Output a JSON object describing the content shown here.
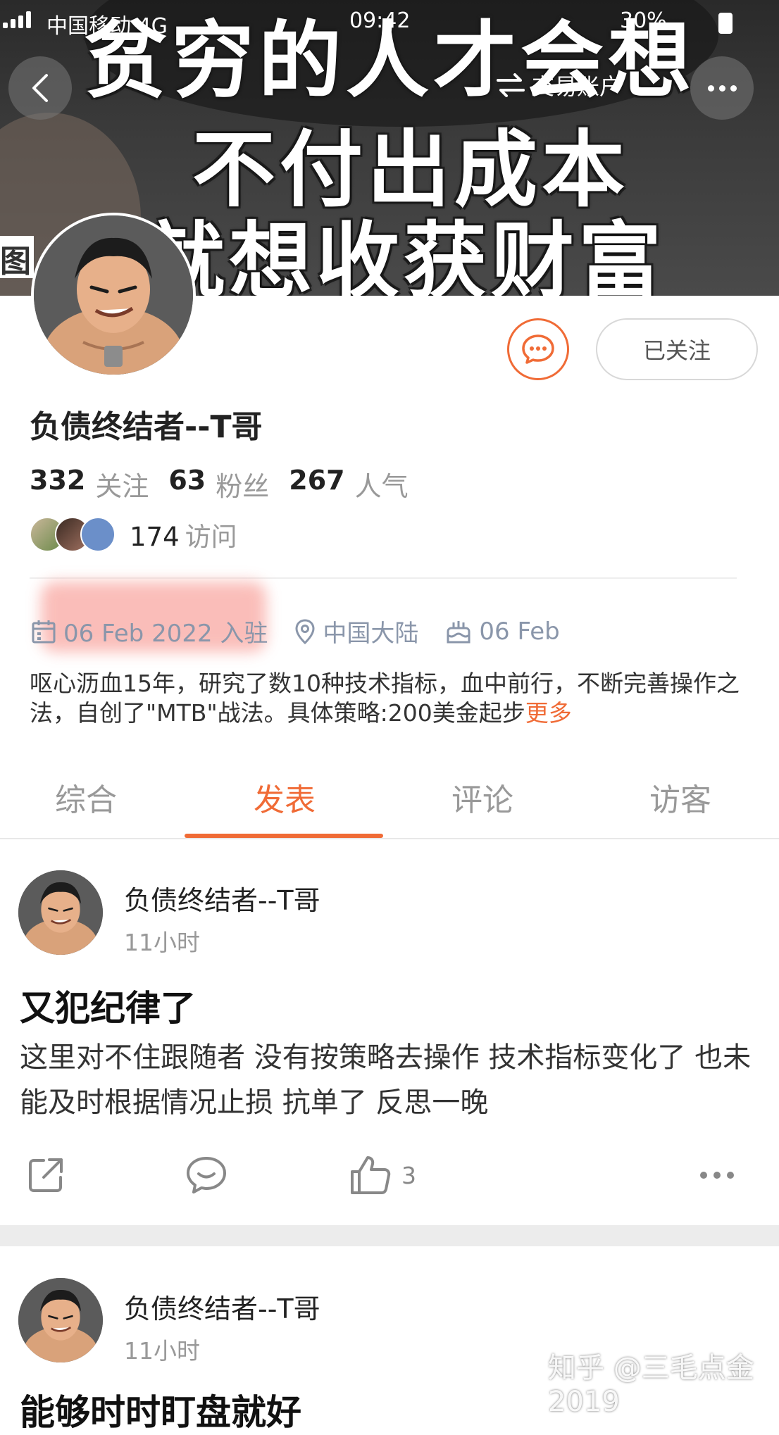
{
  "status_bar": {
    "carrier": "中国移动 4G",
    "time": "09:42",
    "battery": "30%"
  },
  "cover": {
    "line1": "贫穷的人才会想",
    "line2": "不付出成本",
    "line3": "就想收获财富",
    "side": "图"
  },
  "nav": {
    "trade_label": "交易账户"
  },
  "profile": {
    "follow_label": "已关注",
    "name": "负债终结者--T哥",
    "stats": [
      {
        "value": "332",
        "label": "关注"
      },
      {
        "value": "63",
        "label": "粉丝"
      },
      {
        "value": "267",
        "label": "人气"
      }
    ],
    "visits_count": "174",
    "visits_label": "访问",
    "joined": "06 Feb 2022 入驻",
    "location": "中国大陆",
    "birthday": "06 Feb",
    "bio": "呕心沥血15年，研究了数10种技术指标，血中前行，不断完善操作之法，自创了\"MTB\"战法。具体策略:200美金起步",
    "bio_more": "更多"
  },
  "tabs": [
    {
      "label": "综合"
    },
    {
      "label": "发表"
    },
    {
      "label": "评论"
    },
    {
      "label": "访客"
    }
  ],
  "posts": [
    {
      "author": "负债终结者--T哥",
      "time": "11小时",
      "title": "又犯纪律了",
      "body": "这里对不住跟随者 没有按策略去操作 技术指标变化了 也未能及时根据情况止损 抗单了 反思一晚",
      "likes": "3"
    },
    {
      "author": "负债终结者--T哥",
      "time": "11小时",
      "title": "能够时时盯盘就好"
    }
  ],
  "watermark": "知乎 @三毛点金2019",
  "colors": {
    "accent": "#f06b36",
    "muted": "#999999",
    "meta": "#8a96aa"
  }
}
